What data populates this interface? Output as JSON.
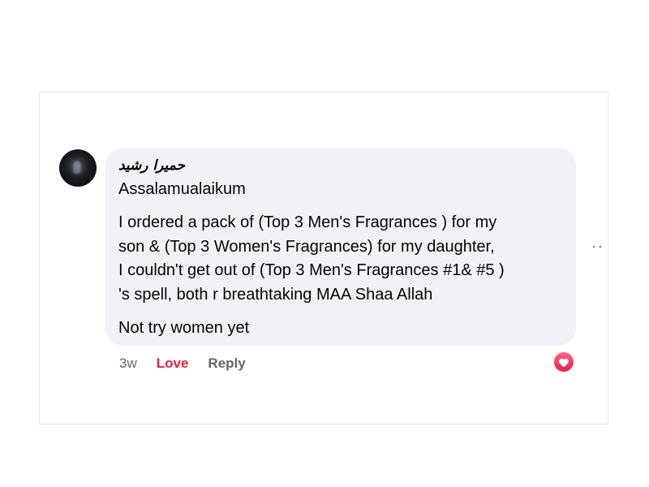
{
  "comment": {
    "author": "حمیرا رشید",
    "greeting": "Assalamualaikum",
    "paragraph_lines": [
      "I ordered a pack of (Top 3 Men's Fragrances ) for my",
      "son & (Top 3 Women's Fragrances) for my daughter,",
      "I couldn't get out of (Top 3 Men's Fragrances #1& #5 )",
      "'s spell, both r breathtaking MAA Shaa Allah"
    ],
    "last_line": "Not try women yet"
  },
  "actions": {
    "time": "3w",
    "love": "Love",
    "reply": "Reply"
  },
  "reaction": {
    "icon": "heart-icon",
    "color": "#e41e3f"
  },
  "more": {
    "icon": "more-options-icon",
    "label": "··"
  },
  "colors": {
    "bubble": "#f0f2f5",
    "love_text": "#e41e3f",
    "secondary_text": "#65676b"
  }
}
